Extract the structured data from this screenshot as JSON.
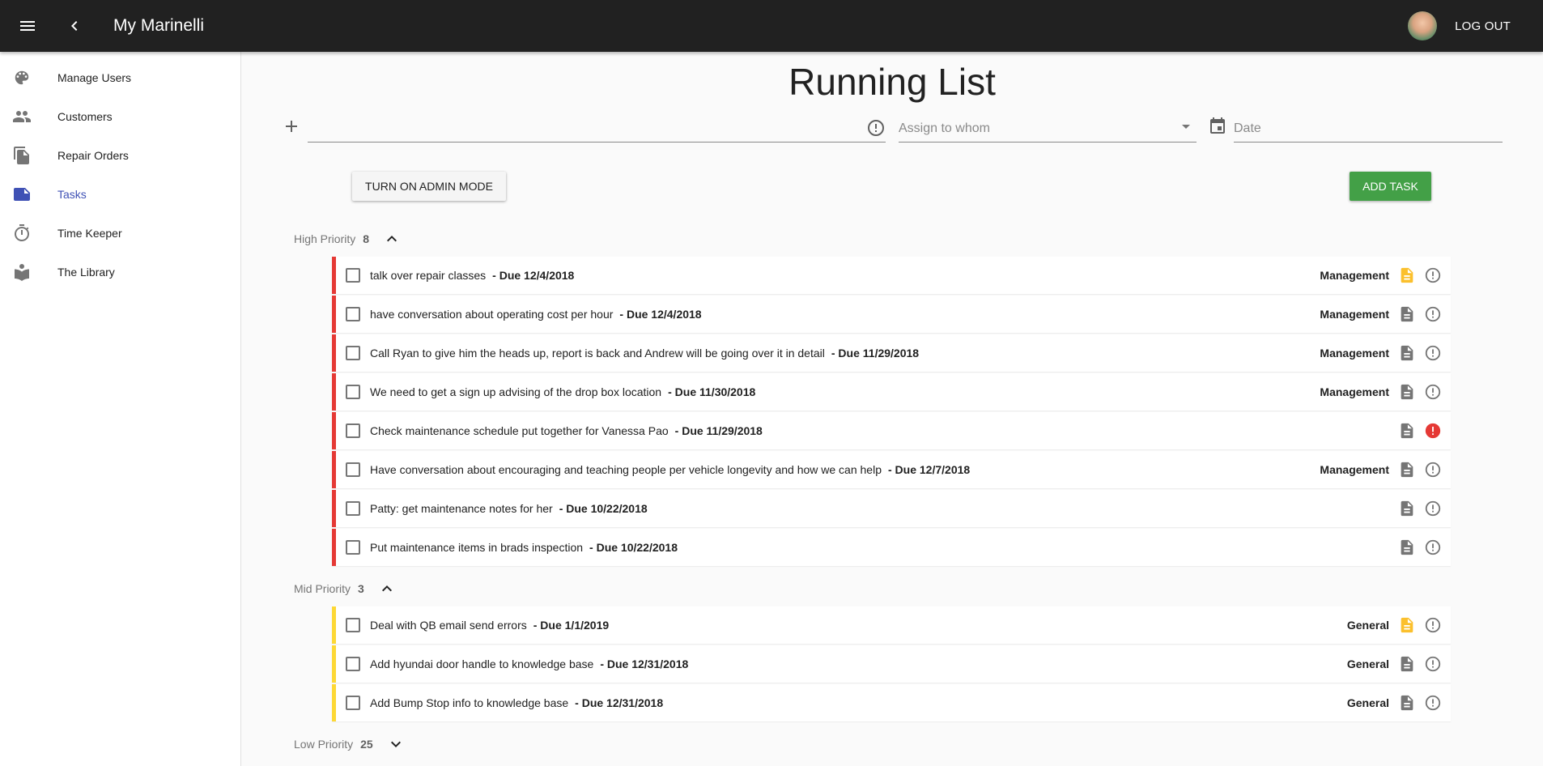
{
  "appbar": {
    "title": "My Marinelli",
    "logout_label": "LOG OUT"
  },
  "sidebar": {
    "items": [
      {
        "label": "Manage Users",
        "icon": "palette-icon",
        "active": false
      },
      {
        "label": "Customers",
        "icon": "people-icon",
        "active": false
      },
      {
        "label": "Repair Orders",
        "icon": "file-copy-icon",
        "active": false
      },
      {
        "label": "Tasks",
        "icon": "note-icon",
        "active": true
      },
      {
        "label": "Time Keeper",
        "icon": "timer-icon",
        "active": false
      },
      {
        "label": "The Library",
        "icon": "book-icon",
        "active": false
      }
    ]
  },
  "main": {
    "title": "Running List",
    "form": {
      "task_value": "",
      "assign_placeholder": "Assign to whom",
      "date_placeholder": "Date"
    },
    "admin_button": "TURN ON ADMIN MODE",
    "add_button": "ADD TASK",
    "groups": [
      {
        "name": "High Priority",
        "count": "8",
        "expanded": true,
        "color": "#e53935",
        "tasks": [
          {
            "text": "talk over repair classes",
            "due": "- Due 12/4/2018",
            "category": "Management",
            "doc_highlight": true,
            "urgent": false
          },
          {
            "text": "have conversation about operating cost per hour",
            "due": "- Due 12/4/2018",
            "category": "Management",
            "doc_highlight": false,
            "urgent": false
          },
          {
            "text": "Call Ryan to give him the heads up, report is back and Andrew will be going over it in detail",
            "due": "- Due 11/29/2018",
            "category": "Management",
            "doc_highlight": false,
            "urgent": false
          },
          {
            "text": "We need to get a sign up advising of the drop box location",
            "due": "- Due 11/30/2018",
            "category": "Management",
            "doc_highlight": false,
            "urgent": false
          },
          {
            "text": "Check maintenance schedule put together for Vanessa Pao",
            "due": "- Due 11/29/2018",
            "category": "",
            "doc_highlight": false,
            "urgent": true
          },
          {
            "text": "Have conversation about encouraging and teaching people per vehicle longevity and how we can help",
            "due": "- Due 12/7/2018",
            "category": "Management",
            "doc_highlight": false,
            "urgent": false
          },
          {
            "text": "Patty: get maintenance notes for her",
            "due": "- Due 10/22/2018",
            "category": "",
            "doc_highlight": false,
            "urgent": false
          },
          {
            "text": "Put maintenance items in brads inspection",
            "due": "- Due 10/22/2018",
            "category": "",
            "doc_highlight": false,
            "urgent": false
          }
        ]
      },
      {
        "name": "Mid Priority",
        "count": "3",
        "expanded": true,
        "color": "#fdd835",
        "tasks": [
          {
            "text": "Deal with QB email send errors",
            "due": "- Due 1/1/2019",
            "category": "General",
            "doc_highlight": true,
            "urgent": false
          },
          {
            "text": "Add hyundai door handle to knowledge base",
            "due": "- Due 12/31/2018",
            "category": "General",
            "doc_highlight": false,
            "urgent": false
          },
          {
            "text": "Add Bump Stop info to knowledge base",
            "due": "- Due 12/31/2018",
            "category": "General",
            "doc_highlight": false,
            "urgent": false
          }
        ]
      },
      {
        "name": "Low Priority",
        "count": "25",
        "expanded": false,
        "color": "",
        "tasks": []
      }
    ]
  },
  "colors": {
    "appbar": "#212121",
    "accent": "#3f51b5",
    "add_button": "#43a047",
    "doc_highlight": "#fbc02d",
    "urgent": "#e53935",
    "icon": "#757575"
  }
}
